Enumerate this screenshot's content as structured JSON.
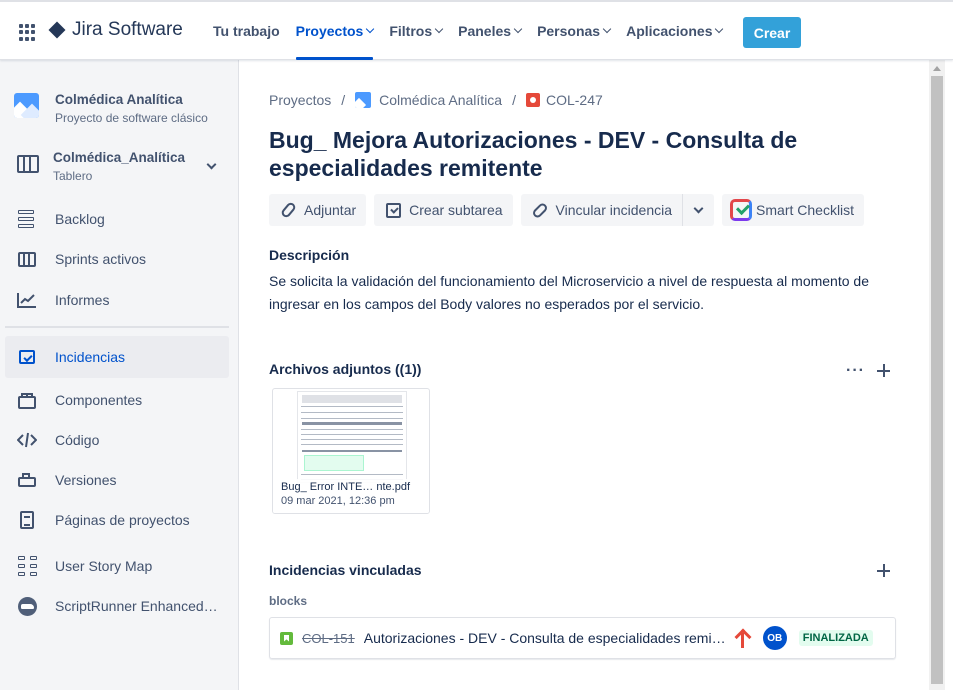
{
  "topbar": {
    "logo_text": "Jira Software",
    "nav": [
      {
        "label": "Tu trabajo",
        "has_chevron": false
      },
      {
        "label": "Proyectos",
        "has_chevron": true,
        "active": true
      },
      {
        "label": "Filtros",
        "has_chevron": true
      },
      {
        "label": "Paneles",
        "has_chevron": true
      },
      {
        "label": "Personas",
        "has_chevron": true
      },
      {
        "label": "Aplicaciones",
        "has_chevron": true
      }
    ],
    "create_label": "Crear",
    "accent_color": "#33a1d9"
  },
  "sidebar": {
    "project_name": "Colmédica Analítica",
    "project_type": "Proyecto de software clásico",
    "board_name": "Colmédica_Analítica",
    "board_type": "Tablero",
    "items": [
      {
        "label": "Backlog",
        "icon": "backlog-icon"
      },
      {
        "label": "Sprints activos",
        "icon": "sprints-icon"
      },
      {
        "label": "Informes",
        "icon": "reports-icon"
      },
      {
        "label": "Incidencias",
        "icon": "issues-icon",
        "active": true
      },
      {
        "label": "Componentes",
        "icon": "components-icon"
      },
      {
        "label": "Código",
        "icon": "code-icon"
      },
      {
        "label": "Versiones",
        "icon": "versions-icon"
      },
      {
        "label": "Páginas de proyectos",
        "icon": "pages-icon"
      },
      {
        "label": "User Story Map",
        "icon": "story-map-icon"
      },
      {
        "label": "ScriptRunner Enhanced Search",
        "icon": "scriptrunner-icon"
      }
    ]
  },
  "issue": {
    "breadcrumbs": {
      "root": "Proyectos",
      "project": "Colmédica Analítica",
      "key": "COL-247"
    },
    "title": "Bug_ Mejora Autorizaciones - DEV - Consulta de especialidades remitente",
    "actions": {
      "attach": "Adjuntar",
      "subtask": "Crear subtarea",
      "link": "Vincular incidencia",
      "checklist": "Smart Checklist"
    },
    "description_heading": "Descripción",
    "description": "Se solicita la validación del funcionamiento del Microservicio a nivel de respuesta al momento de ingresar en los campos del Body valores no esperados por el servicio.",
    "attachments_heading": "Archivos adjuntos ((1))",
    "attachments_more": "···",
    "attachment": {
      "name": "Bug_ Error INTE…  nte.pdf",
      "date": "09 mar 2021, 12:36 pm"
    },
    "linked_heading": "Incidencias vinculadas",
    "link_type": "blocks",
    "linked_issue": {
      "key": "COL-151",
      "summary": "Autorizaciones - DEV - Consulta de especialidades remitente",
      "assignee_initials": "OB",
      "status": "FINALIZADA",
      "priority": "highest"
    }
  }
}
